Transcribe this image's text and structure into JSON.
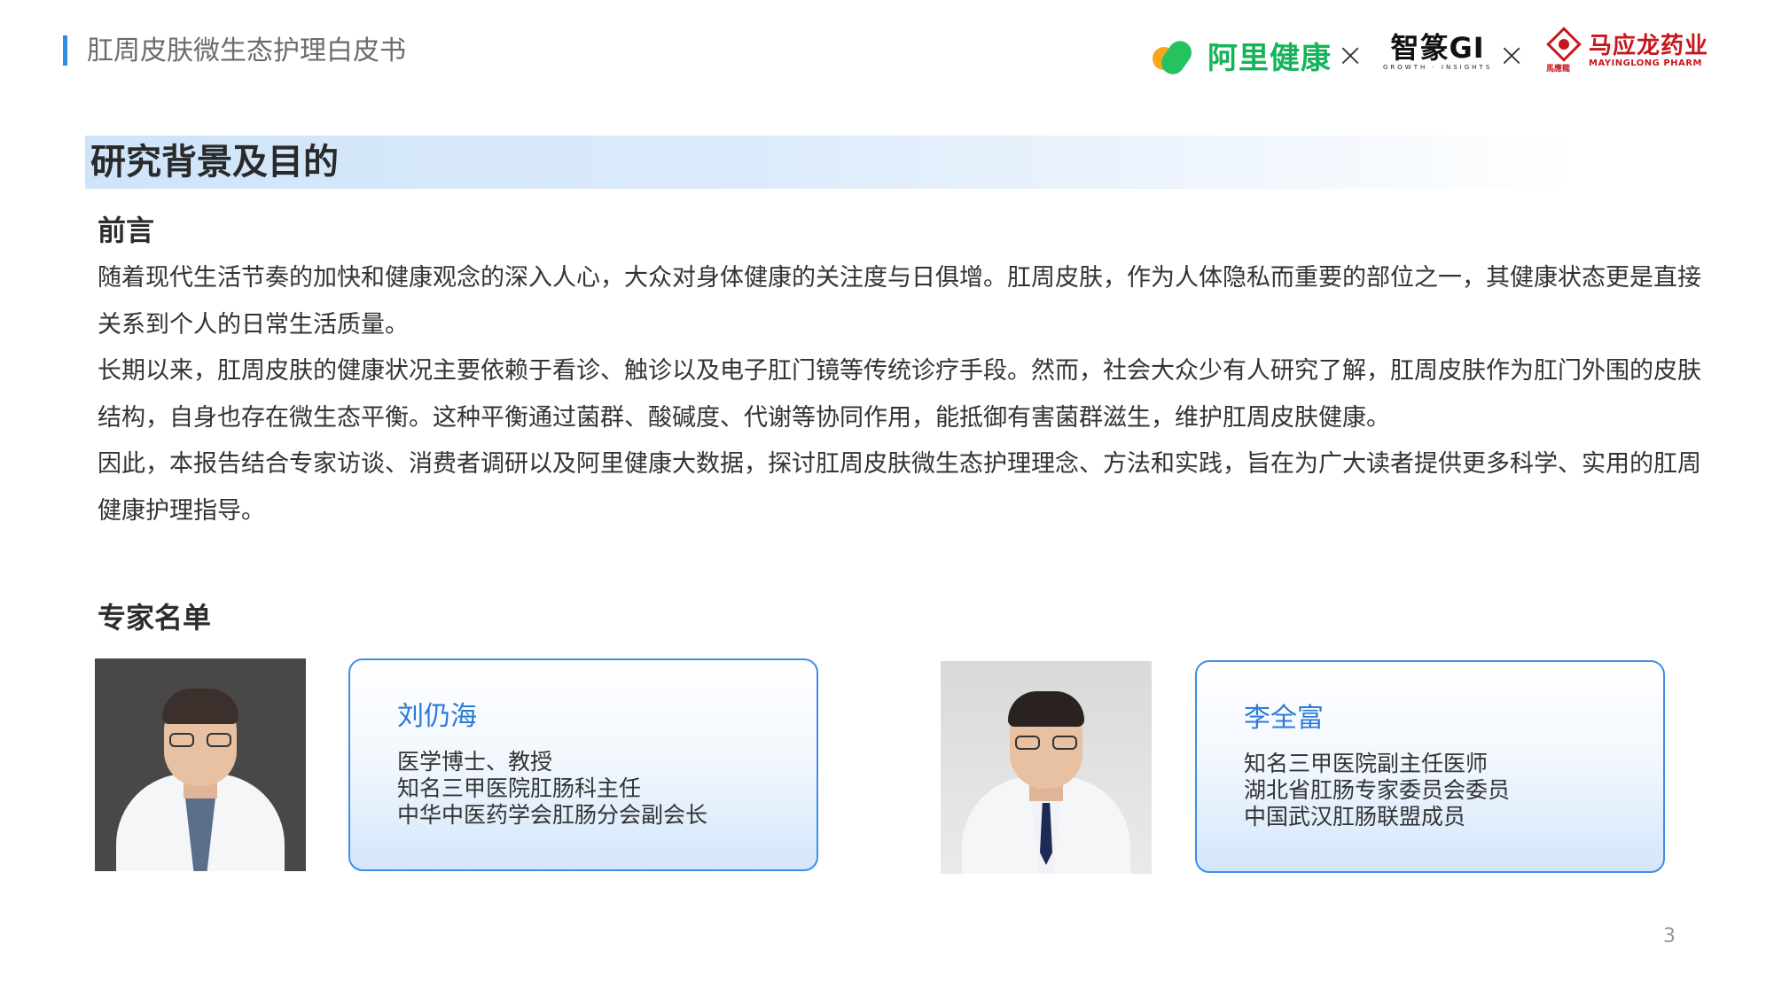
{
  "header": {
    "title": "肛周皮肤微生态护理白皮书",
    "logos": {
      "alihealth": "阿里健康",
      "separator": "×",
      "zhizhuan": "智篆GI",
      "zhizhuan_sub": "GROWTH · INSIGHTS",
      "mayinglong_cn": "马应龙药业",
      "mayinglong_en": "MAYINGLONG PHARM",
      "mayinglong_emblem_text": "馬應龍"
    },
    "accent_color": "#2e8be6"
  },
  "section": {
    "title": "研究背景及目的"
  },
  "intro": {
    "heading": "前言",
    "paragraphs": [
      "随着现代生活节奏的加快和健康观念的深入人心，大众对身体健康的关注度与日俱增。肛周皮肤，作为人体隐私而重要的部位之一，其健康状态更是直接关系到个人的日常生活质量。",
      "长期以来，肛周皮肤的健康状况主要依赖于看诊、触诊以及电子肛门镜等传统诊疗手段。然而，社会大众少有人研究了解，肛周皮肤作为肛门外围的皮肤结构，自身也存在微生态平衡。这种平衡通过菌群、酸碱度、代谢等协同作用，能抵御有害菌群滋生，维护肛周皮肤健康。",
      "因此，本报告结合专家访谈、消费者调研以及阿里健康大数据，探讨肛周皮肤微生态护理理念、方法和实践，旨在为广大读者提供更多科学、实用的肛周健康护理指导。"
    ]
  },
  "experts": {
    "heading": "专家名单",
    "list": [
      {
        "name": "刘仍海",
        "lines": [
          "医学博士、教授",
          "知名三甲医院肛肠科主任",
          "中华中医药学会肛肠分会副会长"
        ]
      },
      {
        "name": "李全富",
        "lines": [
          "知名三甲医院副主任医师",
          "湖北省肛肠专家委员会委员",
          "中国武汉肛肠联盟成员"
        ]
      }
    ]
  },
  "page_number": "3"
}
